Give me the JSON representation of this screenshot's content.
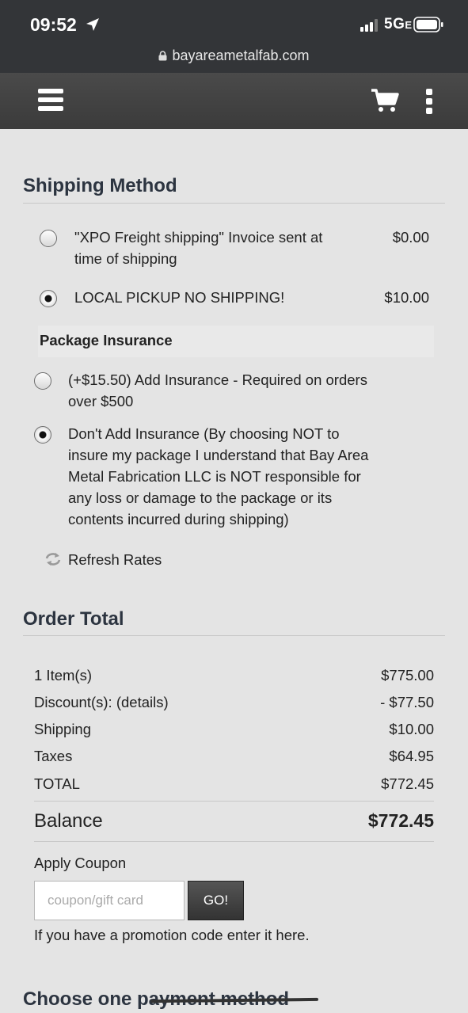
{
  "status_bar": {
    "time": "09:52",
    "network": "5G",
    "network_sub": "E"
  },
  "browser": {
    "url": "bayareametalfab.com"
  },
  "shipping": {
    "title": "Shipping Method",
    "options": [
      {
        "label_line1": "\"XPO Freight shipping\" Invoice sent at",
        "label_line2": "time of shipping",
        "price": "$0.00",
        "selected": false
      },
      {
        "label_line1": "LOCAL PICKUP NO SHIPPING!",
        "price": "$10.00",
        "selected": true
      }
    ]
  },
  "insurance": {
    "title": "Package Insurance",
    "options": [
      {
        "lines": [
          "(+$15.50) Add Insurance - Required on orders",
          "over $500"
        ],
        "selected": false
      },
      {
        "lines": [
          "Don't Add Insurance (By choosing NOT to",
          "insure my package I understand that Bay Area",
          "Metal Fabrication LLC is NOT responsible for",
          "any loss or damage to the package or its",
          "contents incurred during shipping)"
        ],
        "selected": true
      }
    ],
    "refresh_label": "Refresh Rates"
  },
  "order_total": {
    "title": "Order Total",
    "rows": [
      {
        "label": "1 Item(s)",
        "value": "$775.00"
      },
      {
        "label": "Discount(s):",
        "link": "(details)",
        "value": "- $77.50"
      },
      {
        "label": "Shipping",
        "value": "$10.00"
      },
      {
        "label": "Taxes",
        "value": "$64.95"
      },
      {
        "label": "TOTAL",
        "value": "$772.45"
      }
    ],
    "balance_label": "Balance",
    "balance_value": "$772.45"
  },
  "coupon": {
    "label": "Apply Coupon",
    "placeholder": "coupon/gift card",
    "button": "GO!",
    "hint": "If you have a promotion code enter it here."
  },
  "payment": {
    "title": "Choose one payment method"
  },
  "colors": {
    "header_bg": "#3b3b3b",
    "status_bg": "#333538",
    "page_bg": "#e4e4e4",
    "heading": "#2c3440"
  }
}
